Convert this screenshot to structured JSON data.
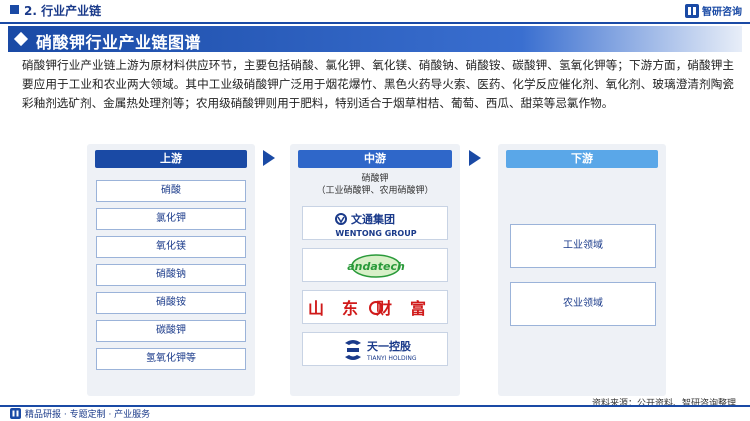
{
  "header": {
    "section_label": "2. 行业产业链",
    "brand_name": "智研咨询"
  },
  "title": "硝酸钾行业产业链图谱",
  "description": "硝酸钾行业产业链上游为原材料供应环节，主要包括硝酸、氯化钾、氧化镁、硝酸钠、硝酸铵、碳酸钾、氢氧化钾等；下游方面，硝酸钾主要应用于工业和农业两大领域。其中工业级硝酸钾广泛用于烟花爆竹、黑色火药导火索、医药、化学反应催化剂、氧化剂、玻璃澄清剂陶瓷彩釉剂选矿剂、金属热处理剂等；农用级硝酸钾则用于肥料，特别适合于烟草柑桔、葡萄、西瓜、甜菜等忌氯作物。",
  "upstream": {
    "label": "上游",
    "items": [
      "硝酸",
      "氯化钾",
      "氧化镁",
      "硝酸钠",
      "硝酸铵",
      "碳酸钾",
      "氢氧化钾等"
    ]
  },
  "midstream": {
    "label": "中游",
    "product": "硝酸钾",
    "product_types": "（工业硝酸钾、农用硝酸钾）",
    "companies": [
      {
        "cn": "文通集团",
        "en": "WENTONG GROUP"
      },
      {
        "cn": "",
        "en": "andatech"
      },
      {
        "cn": "山东财富",
        "en": ""
      },
      {
        "cn": "天一控股",
        "en": "TIANYI HOLDING"
      }
    ]
  },
  "downstream": {
    "label": "下游",
    "items": [
      "工业领域",
      "农业领域"
    ]
  },
  "footer": {
    "services": "精品研报 · 专题定制 · 产业服务",
    "source": "资料来源：公开资料、智研咨询整理"
  },
  "colors": {
    "primary": "#1a4aa5",
    "mid": "#2f67c9",
    "light": "#5aa7e8",
    "panel": "#eef1f6"
  }
}
